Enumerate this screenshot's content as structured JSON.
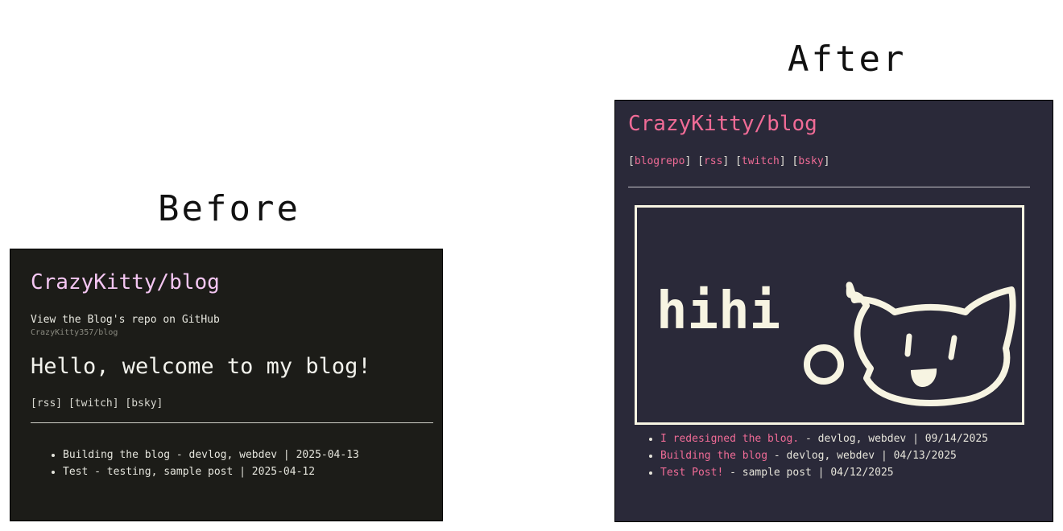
{
  "captions": {
    "before": "Before",
    "after": "After"
  },
  "before": {
    "title": "CrazyKitty/blog",
    "repo_link": "View the Blog's repo on GitHub",
    "repo_sub": "CrazyKitty357/blog",
    "welcome": "Hello, welcome to my blog!",
    "links": "[rss] [twitch] [bsky]",
    "posts": [
      "Building the blog - devlog, webdev | 2025-04-13",
      "Test - testing, sample post | 2025-04-12"
    ]
  },
  "after": {
    "title": "CrazyKitty/blog",
    "links": [
      "blogrepo",
      "rss",
      "twitch",
      "bsky"
    ],
    "banner_text": "hihi",
    "posts": [
      {
        "title": "I redesigned the blog.",
        "meta": " - devlog, webdev | 09/14/2025"
      },
      {
        "title": "Building the blog",
        "meta": " - devlog, webdev | 04/13/2025"
      },
      {
        "title": "Test Post!",
        "meta": " - sample post | 04/12/2025"
      }
    ]
  },
  "colors": {
    "before_bg": "#1c1c18",
    "before_title": "#f4c6f2",
    "after_bg": "#2a2939",
    "after_accent": "#f06b96",
    "banner_ink": "#f7f4e2"
  }
}
